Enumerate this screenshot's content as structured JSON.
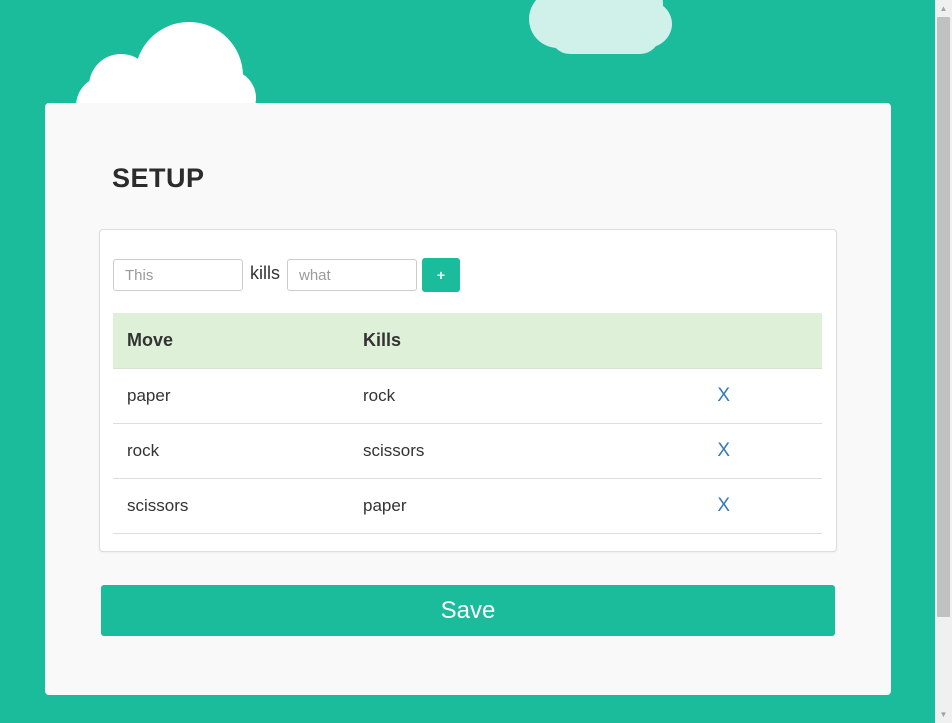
{
  "setup": {
    "title": "SETUP",
    "form": {
      "this_placeholder": "This",
      "kills_label": "kills",
      "what_placeholder": "what",
      "add_label": "+"
    },
    "table": {
      "headers": [
        "Move",
        "Kills",
        ""
      ],
      "rows": [
        {
          "move": "paper",
          "kills": "rock",
          "delete": "X"
        },
        {
          "move": "rock",
          "kills": "scissors",
          "delete": "X"
        },
        {
          "move": "scissors",
          "kills": "paper",
          "delete": "X"
        }
      ]
    },
    "save_label": "Save"
  },
  "colors": {
    "background": "#1abc9c",
    "card": "#f9f9f9",
    "header_row": "#dff0d8",
    "link": "#337ab7"
  }
}
